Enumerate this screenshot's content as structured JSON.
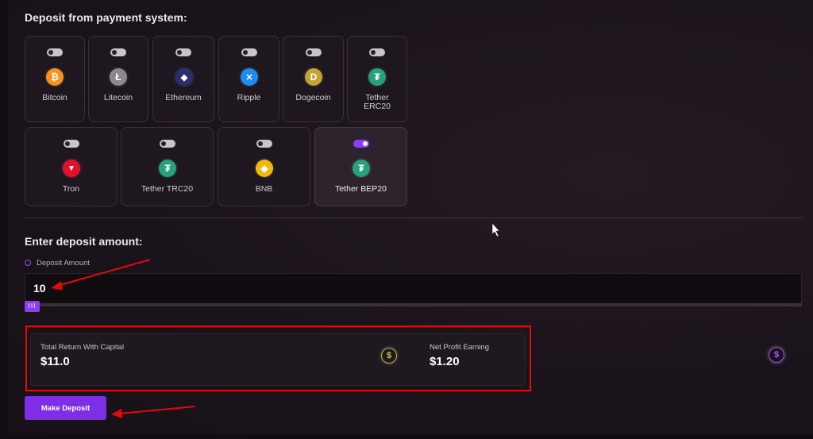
{
  "payment": {
    "heading": "Deposit from payment system:",
    "coins": [
      {
        "label": "Bitcoin",
        "glyph": "₿",
        "icon": "bitcoin-icon",
        "color": "#f7931a",
        "selected": false
      },
      {
        "label": "Litecoin",
        "glyph": "Ł",
        "icon": "litecoin-icon",
        "color": "#8a8a8a",
        "selected": false
      },
      {
        "label": "Ethereum",
        "glyph": "◆",
        "icon": "ethereum-icon",
        "color": "#2a2f6e",
        "selected": false
      },
      {
        "label": "Ripple",
        "glyph": "✕",
        "icon": "ripple-icon",
        "color": "#1d8cf0",
        "selected": false
      },
      {
        "label": "Dogecoin",
        "glyph": "D",
        "icon": "dogecoin-icon",
        "color": "#c2a633",
        "selected": false
      },
      {
        "label": "Tether ERC20",
        "glyph": "₮",
        "icon": "tether-erc20-icon",
        "color": "#26a17b",
        "selected": false
      },
      {
        "label": "Tron",
        "glyph": "▼",
        "icon": "tron-icon",
        "color": "#e5112c",
        "selected": false
      },
      {
        "label": "Tether TRC20",
        "glyph": "₮",
        "icon": "tether-trc20-icon",
        "color": "#26a17b",
        "selected": false
      },
      {
        "label": "BNB",
        "glyph": "◈",
        "icon": "bnb-icon",
        "color": "#f0b90b",
        "selected": false
      },
      {
        "label": "Tether BEP20",
        "glyph": "₮",
        "icon": "tether-bep20-icon",
        "color": "#26a17b",
        "selected": true
      }
    ]
  },
  "amount": {
    "heading": "Enter deposit amount:",
    "label": "Deposit Amount",
    "value": "10",
    "slider_handle": "III",
    "slider_fraction": 0
  },
  "results": {
    "total_title": "Total Return With Capital",
    "total_value": "$11.0",
    "profit_title": "Net Profit Earning",
    "profit_value": "$1.20",
    "dollar_glyph": "$"
  },
  "actions": {
    "make_deposit": "Make Deposit"
  },
  "colors": {
    "accent": "#8b3cf6",
    "annotation": "#e00b0b",
    "dollar_yellow": "#c9c23b",
    "dollar_purple": "#9d5cff"
  }
}
